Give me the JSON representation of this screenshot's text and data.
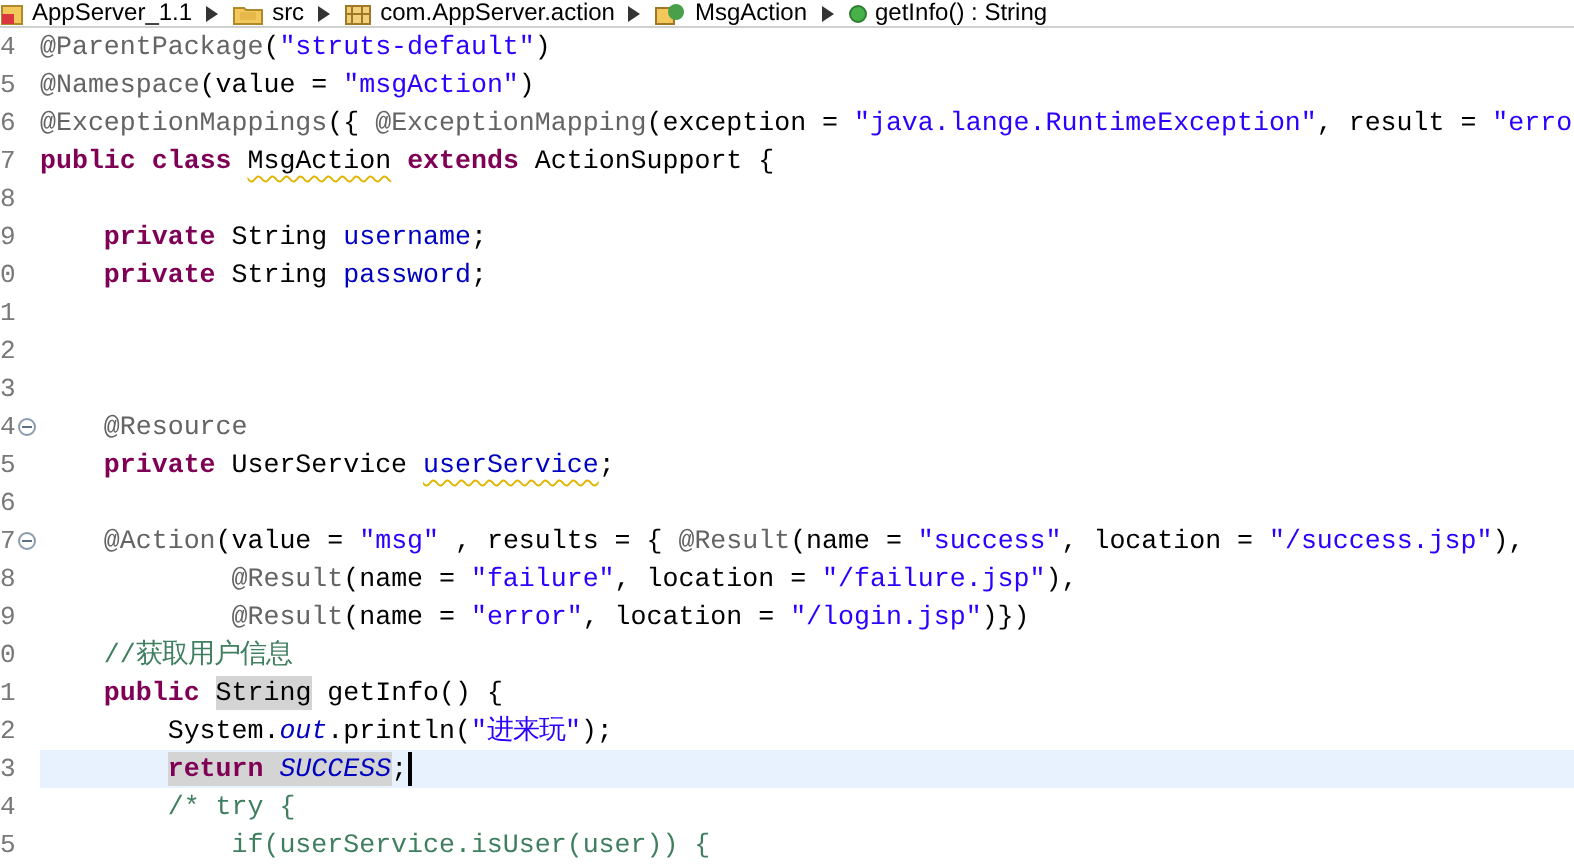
{
  "breadcrumb": [
    {
      "label": "AppServer_1.1",
      "kind": "project"
    },
    {
      "label": "src",
      "kind": "folder"
    },
    {
      "label": "com.AppServer.action",
      "kind": "package"
    },
    {
      "label": "MsgAction",
      "kind": "class"
    },
    {
      "label": "getInfo() : String",
      "kind": "method"
    }
  ],
  "lines": [
    {
      "number": "4",
      "collapsible": false,
      "current": false,
      "tokens": [
        {
          "kind": "annotation",
          "text": "@ParentPackage"
        },
        {
          "kind": "plain",
          "text": "("
        },
        {
          "kind": "string",
          "text": "\"struts-default\""
        },
        {
          "kind": "plain",
          "text": ")"
        }
      ]
    },
    {
      "number": "5",
      "collapsible": false,
      "current": false,
      "tokens": [
        {
          "kind": "annotation",
          "text": "@Namespace"
        },
        {
          "kind": "plain",
          "text": "(value = "
        },
        {
          "kind": "string",
          "text": "\"msgAction\""
        },
        {
          "kind": "plain",
          "text": ")"
        }
      ]
    },
    {
      "number": "6",
      "collapsible": false,
      "current": false,
      "tokens": [
        {
          "kind": "annotation",
          "text": "@ExceptionMappings"
        },
        {
          "kind": "plain",
          "text": "({ "
        },
        {
          "kind": "annotation",
          "text": "@ExceptionMapping"
        },
        {
          "kind": "plain",
          "text": "(exception = "
        },
        {
          "kind": "string",
          "text": "\"java.lange.RuntimeException\""
        },
        {
          "kind": "plain",
          "text": ", result = "
        },
        {
          "kind": "string",
          "text": "\"erro"
        }
      ]
    },
    {
      "number": "7",
      "collapsible": false,
      "current": false,
      "tokens": [
        {
          "kind": "keyword",
          "text": "public"
        },
        {
          "kind": "keyword",
          "text": " class"
        },
        {
          "kind": "plain",
          "text": " MsgAction",
          "warning": true
        },
        {
          "kind": "keyword",
          "text": " extends"
        },
        {
          "kind": "plain",
          "text": " ActionSupport {"
        }
      ]
    },
    {
      "number": "8",
      "collapsible": false,
      "current": false
    },
    {
      "number": "9",
      "collapsible": false,
      "current": false,
      "tokens": [
        {
          "kind": "keyword",
          "text": "    private"
        },
        {
          "kind": "plain",
          "text": " String "
        },
        {
          "kind": "field",
          "text": "username"
        },
        {
          "kind": "plain",
          "text": ";"
        }
      ]
    },
    {
      "number": "0",
      "collapsible": false,
      "current": false,
      "tokens": [
        {
          "kind": "keyword",
          "text": "    private"
        },
        {
          "kind": "plain",
          "text": " String "
        },
        {
          "kind": "field",
          "text": "password"
        },
        {
          "kind": "plain",
          "text": ";"
        }
      ]
    },
    {
      "number": "1",
      "collapsible": false,
      "current": false
    },
    {
      "number": "2",
      "collapsible": false,
      "current": false
    },
    {
      "number": "3",
      "collapsible": false,
      "current": false
    },
    {
      "number": "4",
      "collapsible": true,
      "current": false,
      "tokens": [
        {
          "kind": "annotation",
          "text": "    @Resource"
        }
      ]
    },
    {
      "number": "5",
      "collapsible": false,
      "current": false,
      "tokens": [
        {
          "kind": "keyword",
          "text": "    private"
        },
        {
          "kind": "plain",
          "text": " UserService "
        },
        {
          "kind": "field",
          "text": "userService",
          "warning": true
        },
        {
          "kind": "plain",
          "text": ";"
        }
      ]
    },
    {
      "number": "6",
      "collapsible": false,
      "current": false
    },
    {
      "number": "7",
      "collapsible": true,
      "current": false,
      "tokens": [
        {
          "kind": "annotation",
          "text": "    @Action"
        },
        {
          "kind": "plain",
          "text": "(value = "
        },
        {
          "kind": "string",
          "text": "\"msg\""
        },
        {
          "kind": "plain",
          "text": " , results = { "
        },
        {
          "kind": "annotation",
          "text": "@Result"
        },
        {
          "kind": "plain",
          "text": "(name = "
        },
        {
          "kind": "string",
          "text": "\"success\""
        },
        {
          "kind": "plain",
          "text": ", location = "
        },
        {
          "kind": "string",
          "text": "\"/success.jsp\""
        },
        {
          "kind": "plain",
          "text": "),"
        }
      ]
    },
    {
      "number": "8",
      "collapsible": false,
      "current": false,
      "tokens": [
        {
          "kind": "annotation",
          "text": "            @Result"
        },
        {
          "kind": "plain",
          "text": "(name = "
        },
        {
          "kind": "string",
          "text": "\"failure\""
        },
        {
          "kind": "plain",
          "text": ", location = "
        },
        {
          "kind": "string",
          "text": "\"/failure.jsp\""
        },
        {
          "kind": "plain",
          "text": "),"
        }
      ]
    },
    {
      "number": "9",
      "collapsible": false,
      "current": false,
      "tokens": [
        {
          "kind": "annotation",
          "text": "            @Result"
        },
        {
          "kind": "plain",
          "text": "(name = "
        },
        {
          "kind": "string",
          "text": "\"error\""
        },
        {
          "kind": "plain",
          "text": ", location = "
        },
        {
          "kind": "string",
          "text": "\"/login.jsp\""
        },
        {
          "kind": "plain",
          "text": ")})"
        }
      ]
    },
    {
      "number": "0",
      "collapsible": false,
      "current": false,
      "tokens": [
        {
          "kind": "comment",
          "text": "    //获取用户信息"
        }
      ]
    },
    {
      "number": "1",
      "collapsible": false,
      "current": false,
      "tokens": [
        {
          "kind": "keyword",
          "text": "    public"
        },
        {
          "kind": "plain",
          "text": " String",
          "marked": true
        },
        {
          "kind": "plain",
          "text": " getInfo() {"
        }
      ]
    },
    {
      "number": "2",
      "collapsible": false,
      "current": false,
      "tokens": [
        {
          "kind": "plain",
          "text": "        System."
        },
        {
          "kind": "static_field",
          "text": "out"
        },
        {
          "kind": "plain",
          "text": ".println("
        },
        {
          "kind": "string",
          "text": "\"进来玩\""
        },
        {
          "kind": "plain",
          "text": ");"
        }
      ]
    },
    {
      "number": "3",
      "collapsible": false,
      "current": true,
      "tokens": [
        {
          "kind": "keyword",
          "text": "        return ",
          "marked": true
        },
        {
          "kind": "static_field",
          "text": "SUCCESS",
          "marked": true
        },
        {
          "kind": "plain",
          "text": ";"
        }
      ]
    },
    {
      "number": "4",
      "collapsible": false,
      "current": false,
      "tokens": [
        {
          "kind": "comment",
          "text": "        /* try {"
        }
      ]
    },
    {
      "number": "5",
      "collapsible": false,
      "current": false,
      "tokens": [
        {
          "kind": "comment",
          "text": "            if(userService.isUser(user)) {"
        }
      ]
    }
  ]
}
